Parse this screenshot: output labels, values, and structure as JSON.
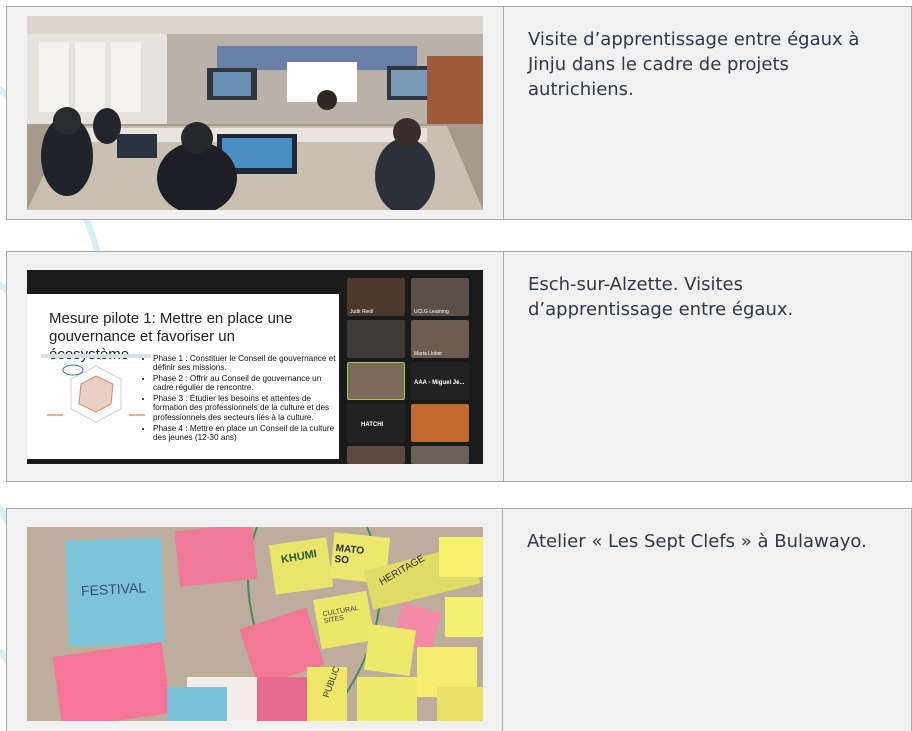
{
  "rows": [
    {
      "caption": "Visite d’apprentissage entre égaux à Jinju dans le cadre de projets autrichiens.",
      "image": "photo-conference-room-jinju"
    },
    {
      "caption": "Esch-sur-Alzette. Visites d’apprentissage entre égaux.",
      "image": "screenshot-video-conference",
      "slide": {
        "title": "Mesure pilote 1: Mettre en place une gouvernance et favoriser un écosystème",
        "bullets": [
          "Phase 1 : Constituer le Conseil de gouvernance et définir ses missions.",
          "Phase 2 : Offrir au Conseil de gouvernance un cadre régulier de rencontre.",
          "Phase 3 : Étudier les besoins et attentes de formation des professionnels de la culture et des professionnels des secteurs liés à la culture.",
          "Phase 4 : Mettre en place un Conseil de la culture des jeunes (12-30 ans)"
        ],
        "participants": [
          "Judit Riedl",
          "UCLG Learning",
          "",
          "Marta Llober",
          "",
          "AAA - Miguel Je...",
          "HATCHI",
          "",
          "",
          ""
        ]
      }
    },
    {
      "caption": "Atelier « Les Sept Clefs » à Bulawayo.",
      "image": "photo-sticky-notes-workshop",
      "notes": [
        "FESTIVAL",
        "KHUMI",
        "MATO SO",
        "HERITAGE",
        "CULTURAL SITES",
        "PUBLIC"
      ]
    }
  ],
  "colors": {
    "border": "#a9a9a9",
    "cell_bg": "#f1f1f1",
    "text": "#2f3a45",
    "deco": "#d8eef5"
  }
}
